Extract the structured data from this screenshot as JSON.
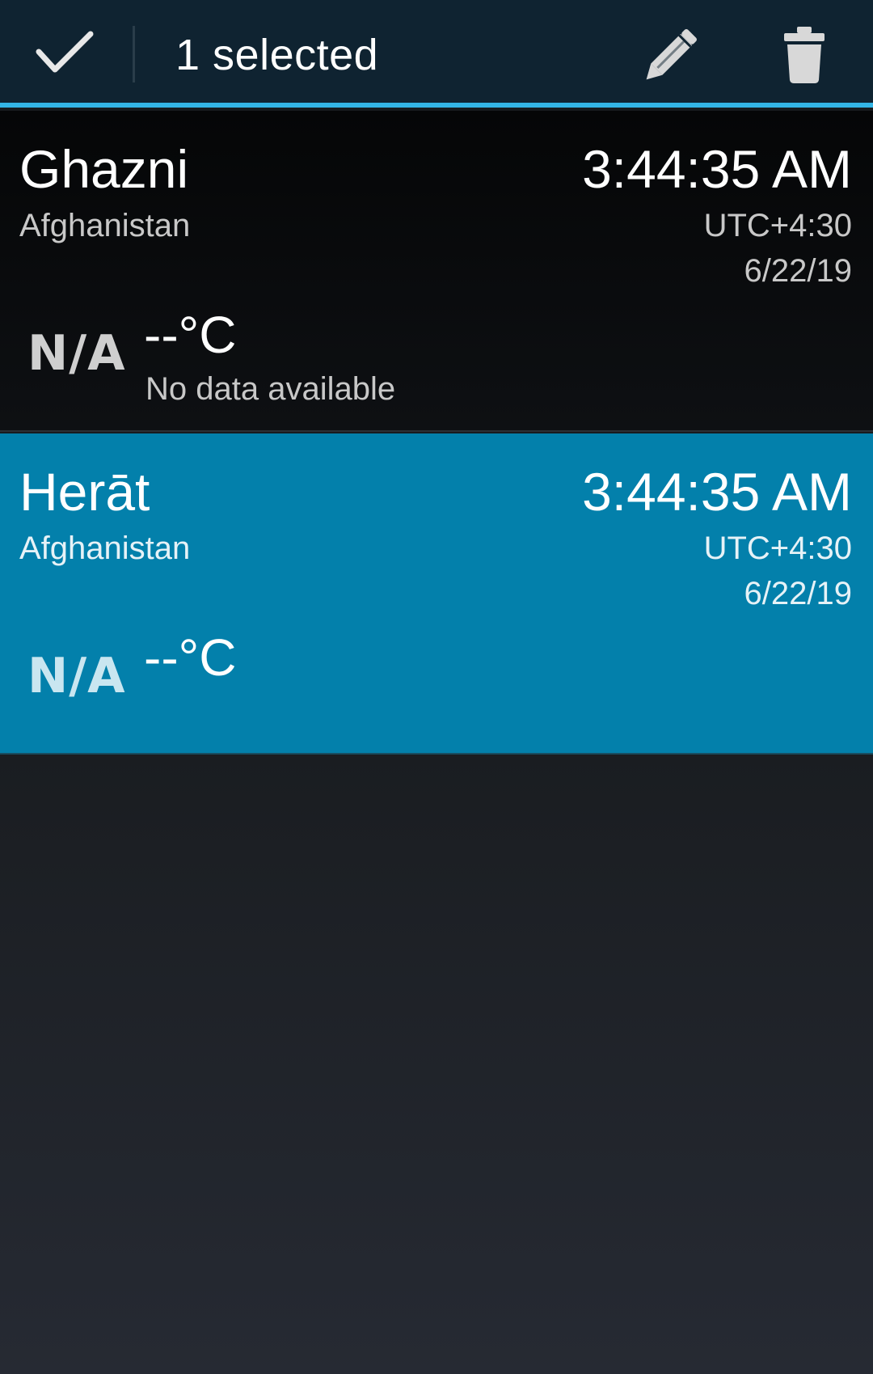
{
  "action_bar": {
    "selected_text": "1 selected",
    "accent_color": "#33b5e5",
    "icons": [
      "check-icon",
      "pencil-icon",
      "trash-icon"
    ]
  },
  "cities": [
    {
      "name": "Ghazni",
      "country": "Afghanistan",
      "time": "3:44:35 AM",
      "utc_offset": "UTC+4:30",
      "date": "6/22/19",
      "weather_icon_text": "N/A",
      "temperature": "--°C",
      "status": "No data available",
      "selected": false
    },
    {
      "name": "Herāt",
      "country": "Afghanistan",
      "time": "3:44:35 AM",
      "utc_offset": "UTC+4:30",
      "date": "6/22/19",
      "weather_icon_text": "N/A",
      "temperature": "--°C",
      "selected": true,
      "highlight_color": "#0380ab"
    }
  ]
}
